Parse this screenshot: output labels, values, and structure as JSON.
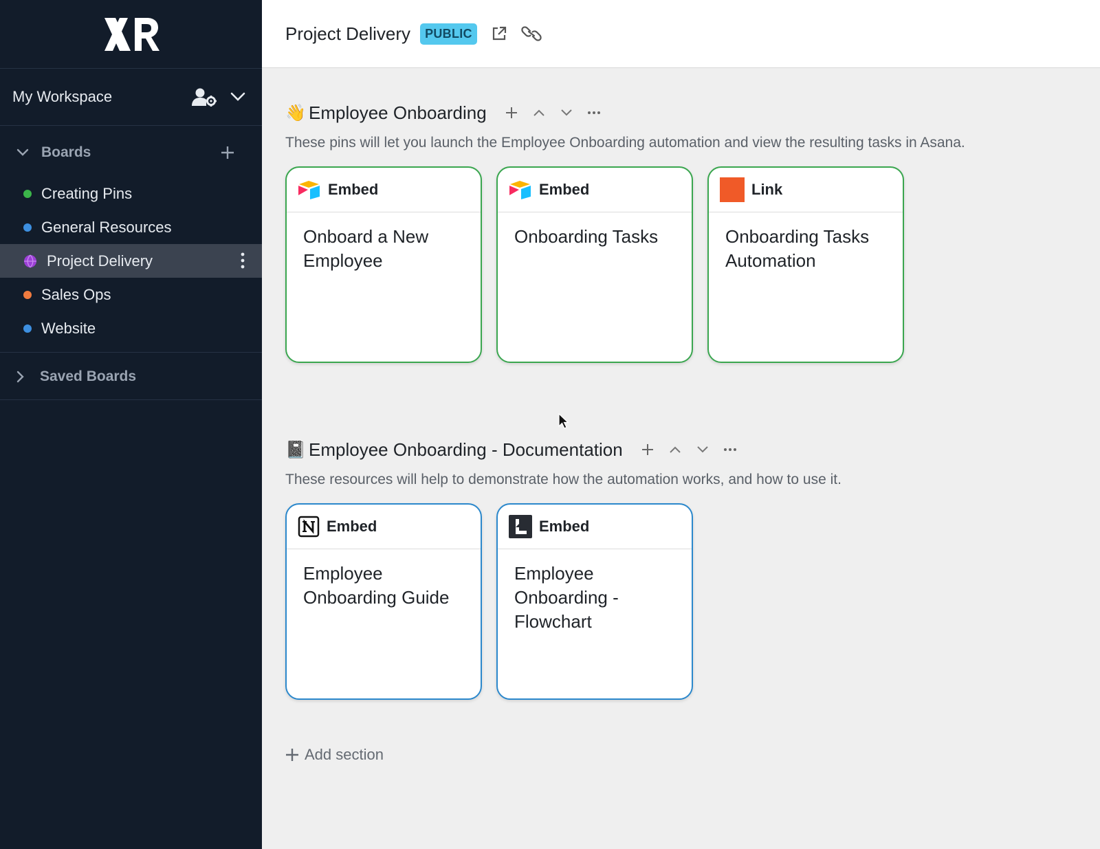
{
  "sidebar": {
    "workspace_name": "My Workspace",
    "boards_label": "Boards",
    "boards": [
      {
        "label": "Creating Pins",
        "color": "#3bb54a"
      },
      {
        "label": "General Resources",
        "color": "#3d8fe0"
      },
      {
        "label": "Project Delivery",
        "color": "#9b3fd6"
      },
      {
        "label": "Sales Ops",
        "color": "#f07b3f"
      },
      {
        "label": "Website",
        "color": "#3d8fe0"
      }
    ],
    "saved_label": "Saved Boards"
  },
  "header": {
    "title": "Project Delivery",
    "badge": "PUBLIC"
  },
  "sections": [
    {
      "emoji": "👋",
      "title": "Employee Onboarding",
      "description": "These pins will let you launch the Employee Onboarding automation and view the resulting tasks in Asana.",
      "cards": [
        {
          "type": "Embed",
          "icon": "airtable-icon",
          "title": "Onboard a New Employee"
        },
        {
          "type": "Embed",
          "icon": "airtable-icon",
          "title": "Onboarding Tasks"
        },
        {
          "type": "Link",
          "icon": "orange-square-icon",
          "title": "Onboarding Tasks Automation"
        }
      ]
    },
    {
      "emoji": "📓",
      "title": "Employee Onboarding - Documentation",
      "description": "These resources will help to demonstrate how the automation works, and how to use it.",
      "cards": [
        {
          "type": "Embed",
          "icon": "notion-icon",
          "title": "Employee Onboarding Guide"
        },
        {
          "type": "Embed",
          "icon": "lucidchart-icon",
          "title": "Employee Onboarding - Flowchart"
        }
      ]
    }
  ],
  "add_section_label": "Add section",
  "colors": {
    "sidebar_bg": "#121c2a",
    "card_green": "#3aa64f",
    "card_blue": "#2b88cc",
    "badge": "#54c8ee"
  }
}
